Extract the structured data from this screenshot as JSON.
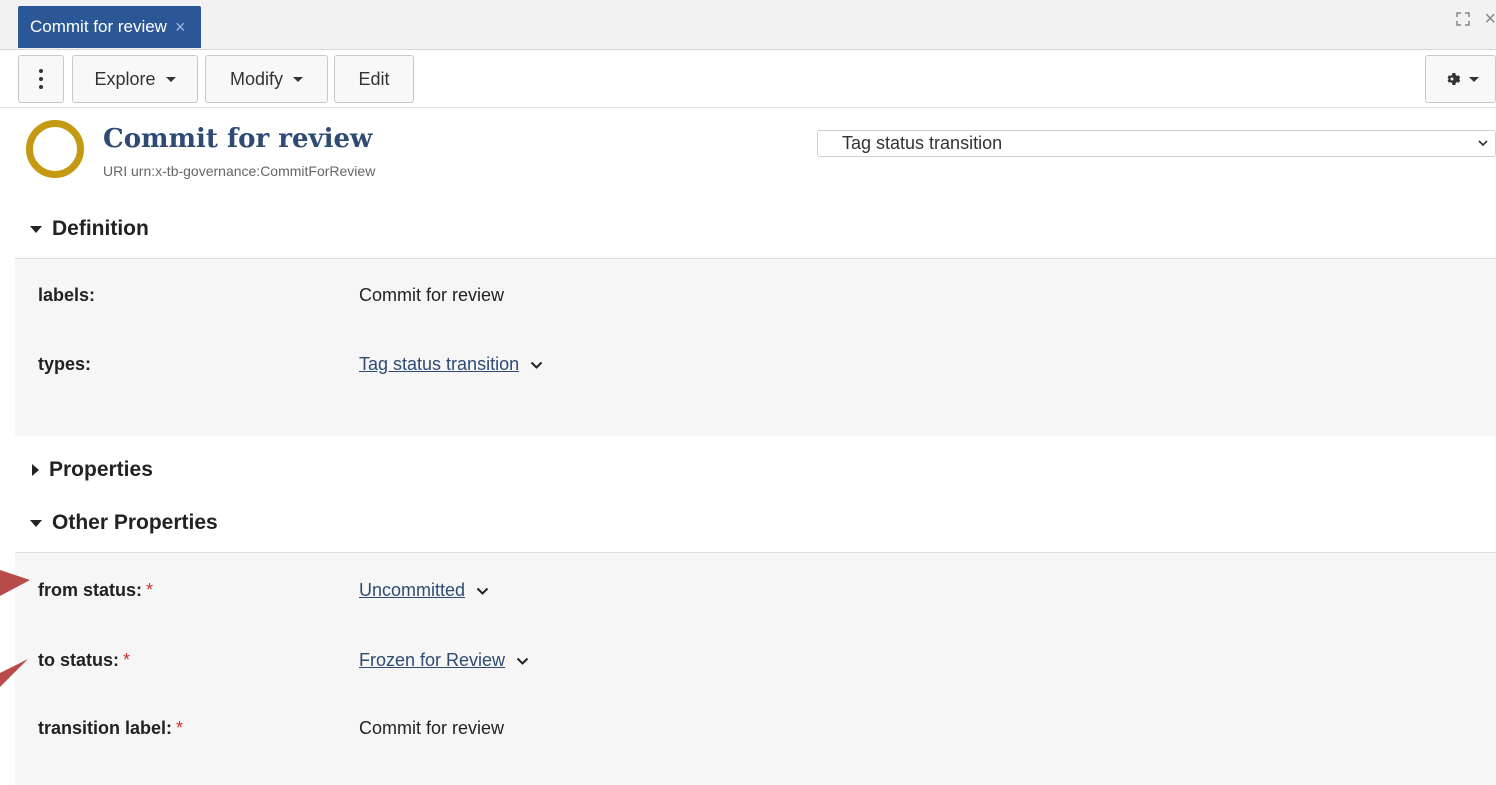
{
  "tab": {
    "label": "Commit for review",
    "close": "×"
  },
  "window_controls": {
    "expand": "⛶",
    "close": "×"
  },
  "toolbar": {
    "explore": "Explore",
    "modify": "Modify",
    "edit": "Edit"
  },
  "header": {
    "title": "Commit for review",
    "uri_label": "URI",
    "uri": "urn:x-tb-governance:CommitForReview",
    "type_select": "Tag status transition"
  },
  "sections": {
    "definition": "Definition",
    "properties": "Properties",
    "other_properties": "Other Properties"
  },
  "definition": {
    "labels_key": "labels:",
    "labels_value": "Commit for review",
    "types_key": "types:",
    "types_value": "Tag status transition"
  },
  "other": {
    "from_key": "from status:",
    "from_value": "Uncommitted",
    "to_key": "to status:",
    "to_value": "Frozen for Review",
    "label_key": "transition label:",
    "label_value": "Commit for review",
    "required_mark": "*"
  },
  "colors": {
    "tab_bg": "#2b5797",
    "link": "#2f4a73",
    "ring": "#c49a12",
    "required": "#d32f2f",
    "arrow": "#b84a4a"
  }
}
